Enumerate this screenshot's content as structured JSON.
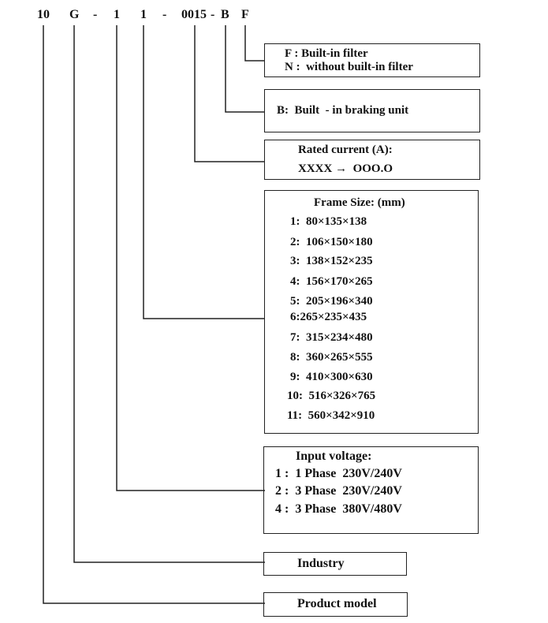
{
  "code": [
    "10",
    "G",
    "-",
    "1",
    "1",
    "-",
    "0015",
    "-",
    "B",
    "F"
  ],
  "filter_box": {
    "lines": [
      "F : Built-in filter",
      "N :  without built-in filter"
    ]
  },
  "braking_box": {
    "text": "B:  Built  - in braking unit"
  },
  "current_box": {
    "title": "Rated current (A):",
    "text": "XXXX →  OOO.O"
  },
  "frame_box": {
    "title": "Frame Size: (mm)",
    "items": [
      "1:  80×135×138",
      "2:  106×150×180",
      "3:  138×152×235",
      "4:  156×170×265",
      "5:  205×196×340",
      "6:265×235×435",
      "7:  315×234×480",
      "8:  360×265×555",
      "9:  410×300×630",
      "10:  516×326×765",
      "11:  560×342×910"
    ]
  },
  "voltage_box": {
    "title": "Input voltage:",
    "items": [
      "1 :  1 Phase  230V/240V",
      "2 :  3 Phase  230V/240V",
      "4 :  3 Phase  380V/480V"
    ]
  },
  "industry_box": {
    "text": "Industry"
  },
  "model_box": {
    "text": "Product model"
  }
}
